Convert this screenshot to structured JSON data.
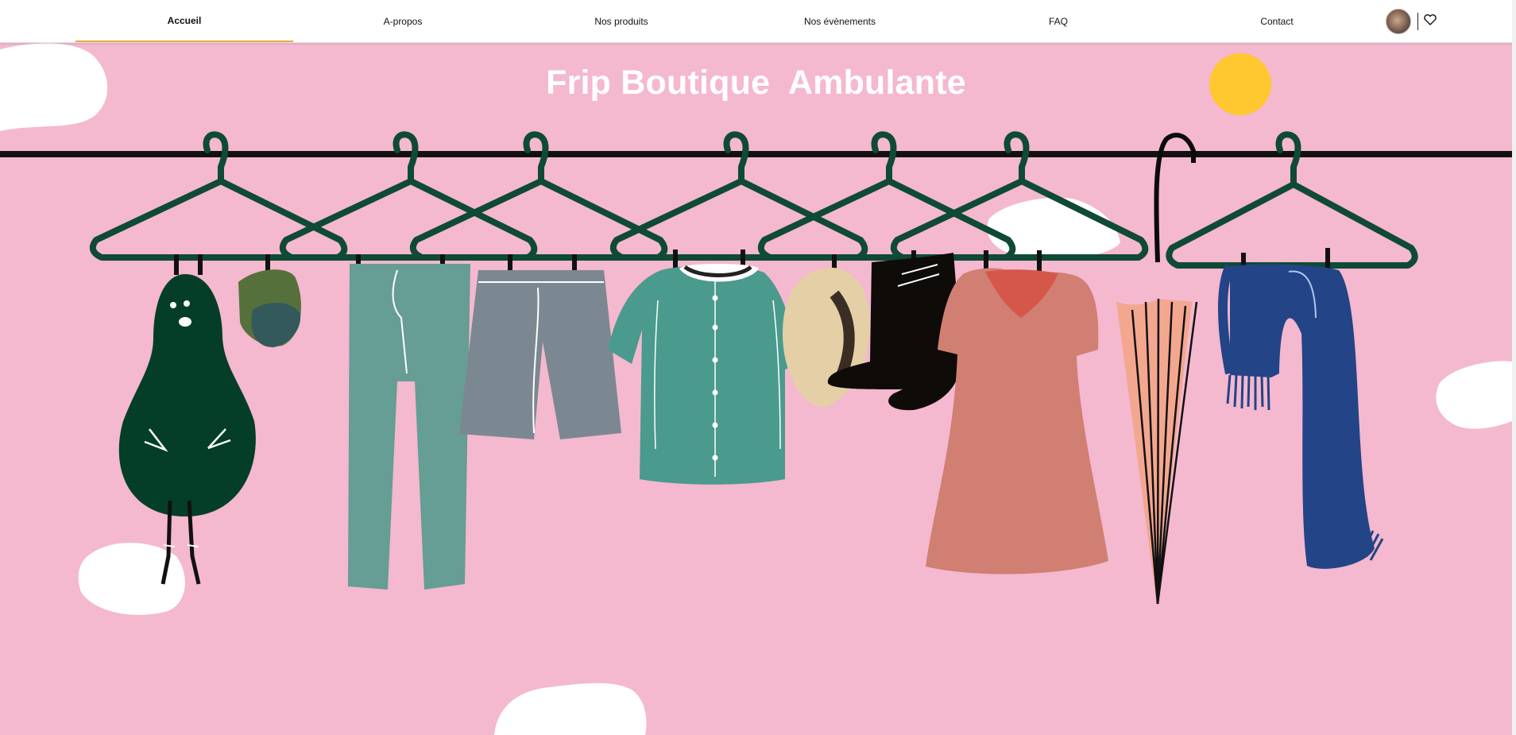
{
  "nav": {
    "items": [
      {
        "label": "Accueil",
        "active": true
      },
      {
        "label": "A-propos",
        "active": false
      },
      {
        "label": "Nos produits",
        "active": false
      },
      {
        "label": "Nos évènements",
        "active": false
      },
      {
        "label": "FAQ",
        "active": false
      },
      {
        "label": "Contact",
        "active": false
      }
    ],
    "icons": {
      "avatar": "user-avatar",
      "favorites": "heart-icon"
    }
  },
  "hero": {
    "title": "Frip Boutique  Ambulante"
  },
  "colors": {
    "background": "#f4b8cf",
    "nav_background": "#ffffff",
    "active_underline": "#e9a83a",
    "hanger": "#0f4a36",
    "rod": "#111111",
    "sun": "#ffc830",
    "cloud": "#ffffff"
  }
}
